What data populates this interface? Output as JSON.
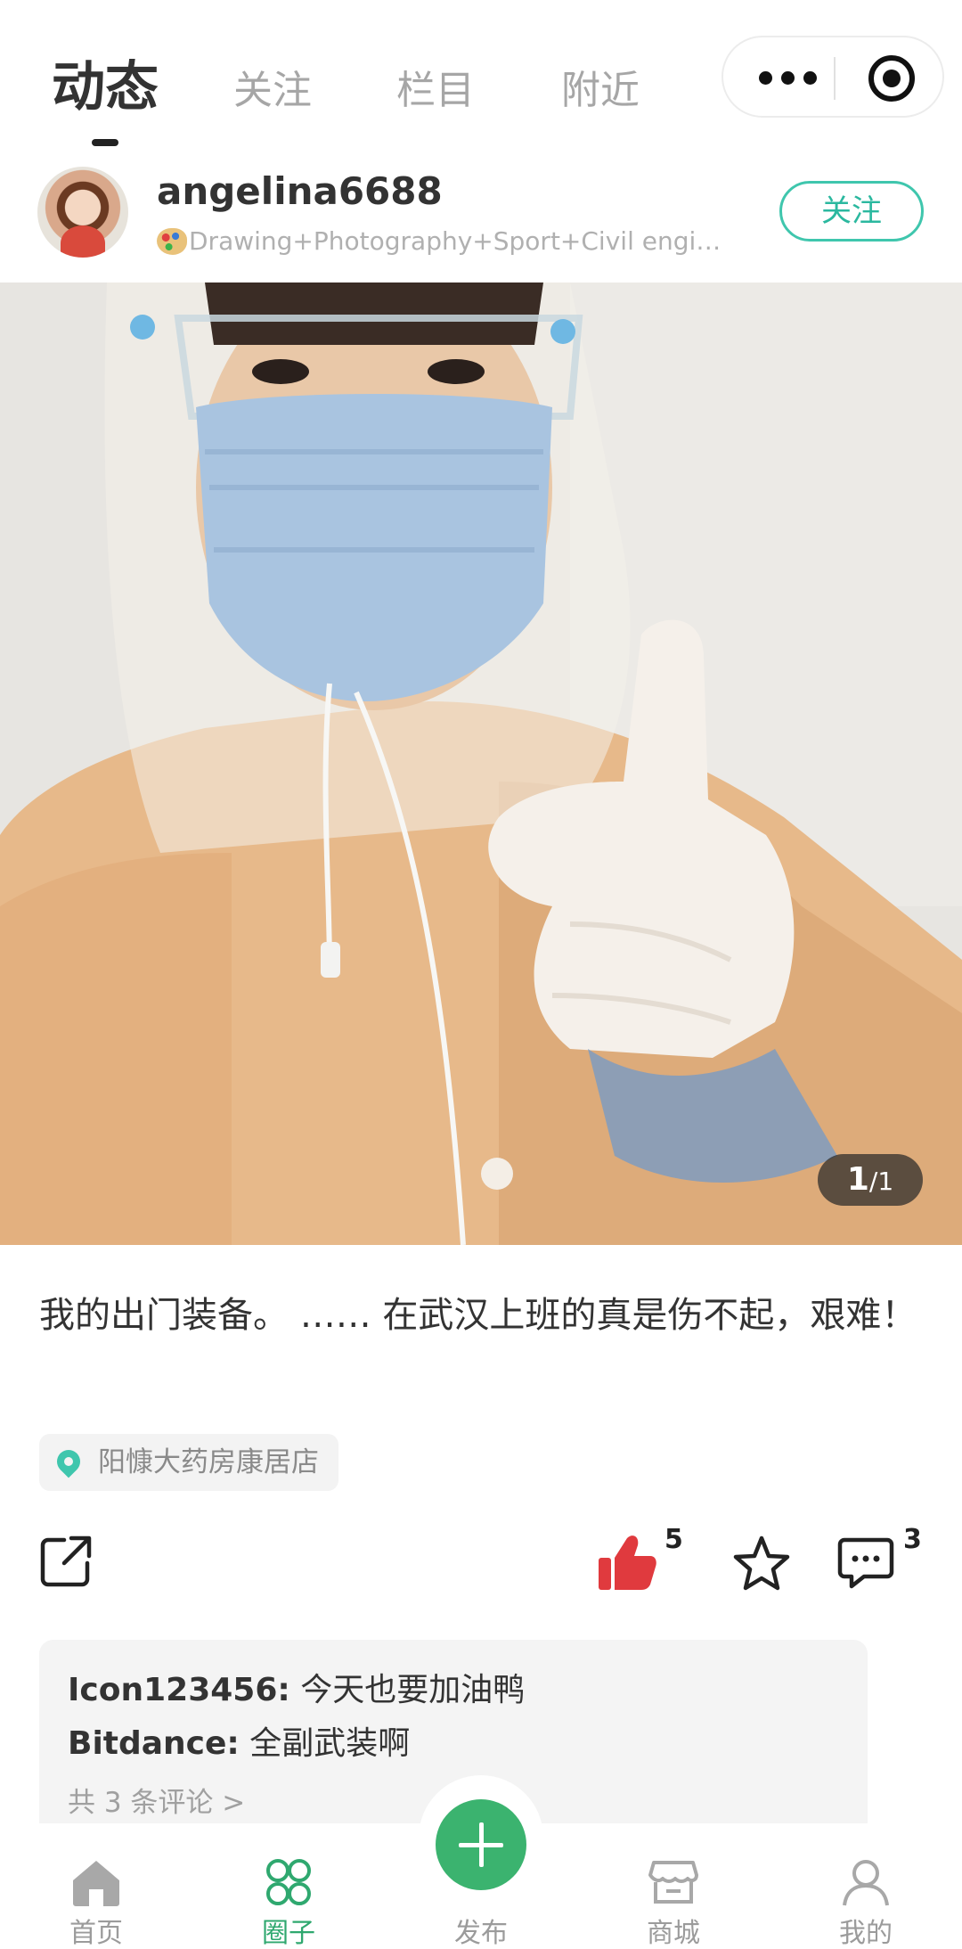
{
  "tabs": {
    "dynamic": "动态",
    "follow": "关注",
    "column": "栏目",
    "nearby": "附近"
  },
  "post": {
    "author": {
      "username": "angelina6688",
      "bio": "Drawing+Photography+Sport+Civil engineer…",
      "follow_label": "关注"
    },
    "image_counter": {
      "current": "1",
      "total": "/1"
    },
    "caption": "我的出门装备。 …… 在武汉上班的真是伤不起，艰难！",
    "location": "阳慷大药房康居店",
    "like_count": "5",
    "comment_count": "3",
    "colors": {
      "accent": "#3fc6ad",
      "like": "#e03a3e",
      "nav_active": "#2fa86f"
    }
  },
  "comments": {
    "items": [
      {
        "user": "Icon123456:",
        "text": " 今天也要加油鸭"
      },
      {
        "user": "Bitdance:",
        "text": " 全副武装啊"
      }
    ],
    "view_all": "共 3 条评论 >"
  },
  "bottom_nav": {
    "home": "首页",
    "circle": "圈子",
    "publish": "发布",
    "shop": "商城",
    "mine": "我的"
  }
}
